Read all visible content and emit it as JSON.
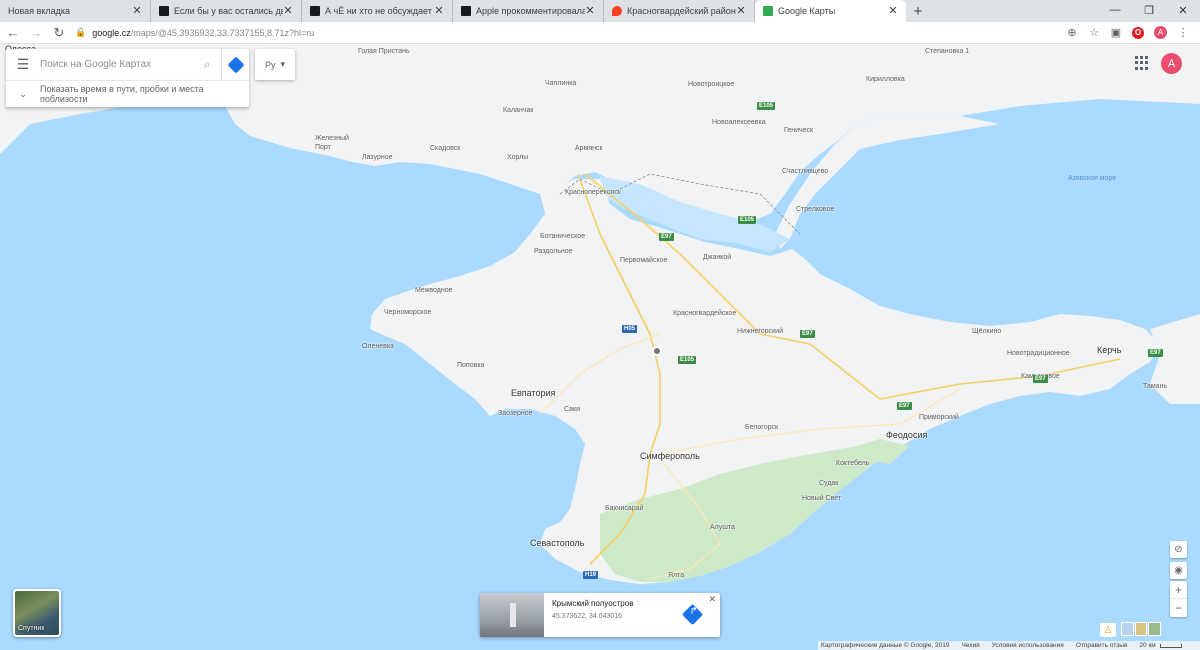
{
  "browser": {
    "tabs": [
      {
        "title": "Новая вкладка",
        "favicon_color": "#dee1e6"
      },
      {
        "title": "Если бы у вас остались два мес",
        "favicon_color": "#1a1a1a"
      },
      {
        "title": "А чЁ ни хто не обсуждает \"бед",
        "favicon_color": "#1a1a1a"
      },
      {
        "title": "Apple прокомментировала обс",
        "favicon_color": "#1a1a1a"
      },
      {
        "title": "Красногвардейский район — Я",
        "favicon_color": "#fc3f1d"
      },
      {
        "title": "Google Карты",
        "favicon_color": "#34a853"
      }
    ],
    "new_tab": "+",
    "window_controls": {
      "minimize": "—",
      "maximize": "❐",
      "close": "✕"
    },
    "url_host": "google.cz",
    "url_path": "/maps/@45.3936932,33.7337155,8.71z?hl=ru",
    "profile_initial": "A"
  },
  "maps": {
    "search_placeholder": "Поиск на Google Картах",
    "suggest_text_line1": "Показать время в пути, пробки и места",
    "suggest_text_line2": "поблизости",
    "layer_glyph": "Ру",
    "avatar_initial": "A",
    "satellite_label": "Спутник",
    "card": {
      "title": "Крымский полуостров",
      "coords": "45.373622, 34.043016",
      "close": "✕"
    },
    "footer": {
      "attribution": "Картографические данные © Google, 2019",
      "country": "Чехия",
      "terms": "Условия использования",
      "feedback": "Отправить отзыв",
      "scale": "20 км"
    },
    "colors": {
      "water": "#aadaff",
      "land": "#f1f3f4",
      "forest": "#cde9c7",
      "accent": "#1a73e8"
    },
    "labels": {
      "odessa": "Одесса",
      "golaya": "Голая Пристань",
      "chaplinka": "Чаплинка",
      "novotroitskoe": "Новотроицкое",
      "stepanovka": "Степановка 1",
      "kirillovka": "Кирилловка",
      "kalanchak": "Каланчак",
      "zheleznyi": "Железный Порт",
      "skadovsk": "Скадовск",
      "lazurnoe": "Лазурное",
      "armyansk": "Армянск",
      "novoalekseevka": "Новоалексеевка",
      "genichesk": "Геническ",
      "shchastlivtsevo": "Счастливцево",
      "azov_sea": "Азовское море",
      "horly": "Хорлы",
      "krasnoperekopsk": "Красноперекопск",
      "strelkovoe": "Стрелковое",
      "botanicheskoe": "Ботаническое",
      "razdolnoe": "Раздольное",
      "pervomayskoe": "Первомайское",
      "dzhankoy": "Джанкой",
      "mezhvodnoe": "Межводное",
      "chernomorskoe": "Черноморское",
      "krasnogvardeyskoe": "Красногвардейское",
      "nizhnegorsky": "Нижнегорский",
      "shchelkino": "Щёлкино",
      "olenevka": "Оленевка",
      "novogrigorovka": "Новотрадиционное",
      "kerch": "Керчь",
      "kamyshevo": "Камышевое",
      "popovka": "Поповка",
      "yevpatoriya": "Евпатория",
      "saki": "Саки",
      "zaozernoe": "Заозерное",
      "tamani": "Тамань",
      "belogorsk": "Белогорск",
      "primorsky": "Приморский",
      "simferopol": "Симферополь",
      "feodosiya": "Феодосия",
      "koktebel": "Коктебель",
      "sudak": "Судак",
      "novyi_svet": "Новый Свет",
      "bakhchisaray": "Бахчисарай",
      "sevastopol": "Севастополь",
      "alushta": "Алушта",
      "yalta": "Ялта"
    },
    "roads": {
      "e105_a": "E105",
      "e105_b": "E105",
      "e97_a": "E97",
      "e97_b": "E97",
      "h05": "H05",
      "e105_c": "E105",
      "e97_c": "E97",
      "e97_d": "E97",
      "h19": "H19",
      "e97_e": "E97"
    }
  }
}
